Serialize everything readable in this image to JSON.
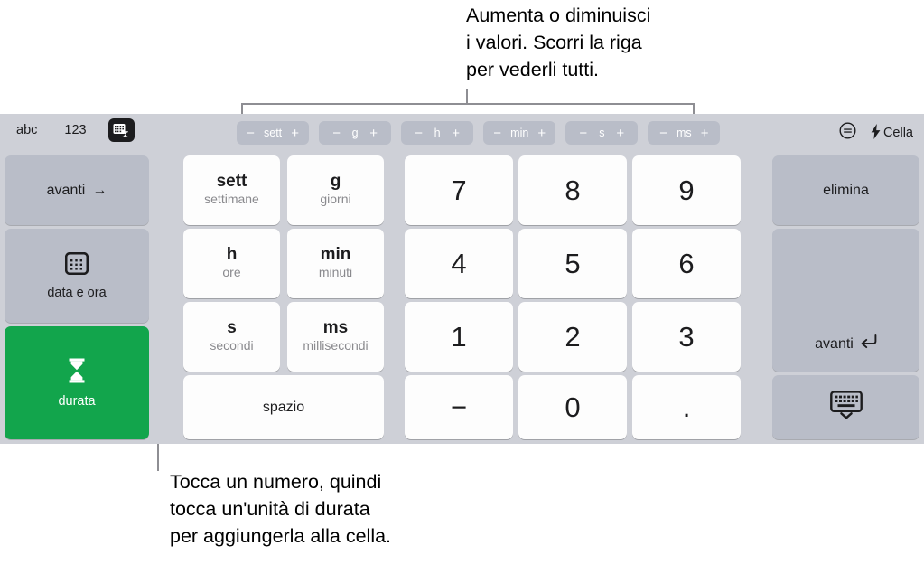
{
  "callouts": {
    "top": "Aumenta o diminuisci\ni valori. Scorri la riga\nper vederli tutti.",
    "bottom": "Tocca un numero, quindi\ntocca un'unità di durata\nper aggiungerla alla cella."
  },
  "toolbar": {
    "modes": [
      {
        "label": "abc",
        "name": "abc-mode"
      },
      {
        "label": "123",
        "name": "numeric-mode"
      }
    ],
    "duration_mode_icon": "duration-keypad-icon",
    "steppers": [
      {
        "unit": "sett",
        "minus": "−",
        "plus": "+"
      },
      {
        "unit": "g",
        "minus": "−",
        "plus": "+"
      },
      {
        "unit": "h",
        "minus": "−",
        "plus": "+"
      },
      {
        "unit": "min",
        "minus": "−",
        "plus": "+"
      },
      {
        "unit": "s",
        "minus": "−",
        "plus": "+"
      },
      {
        "unit": "ms",
        "minus": "−",
        "plus": "+"
      }
    ],
    "format_icon": "format-circle-icon",
    "cell_label": "Cella",
    "cell_icon": "lightning-bolt-icon"
  },
  "left_keys": {
    "next": {
      "label": "avanti",
      "arrow": "→"
    },
    "datetime": {
      "label": "data e ora",
      "icon": "calendar-icon"
    },
    "duration": {
      "label": "durata",
      "icon": "hourglass-icon",
      "color": "#12a54c"
    }
  },
  "unit_keys": [
    {
      "abbr": "sett",
      "full": "settimane"
    },
    {
      "abbr": "g",
      "full": "giorni"
    },
    {
      "abbr": "h",
      "full": "ore"
    },
    {
      "abbr": "min",
      "full": "minuti"
    },
    {
      "abbr": "s",
      "full": "secondi"
    },
    {
      "abbr": "ms",
      "full": "millisecondi"
    }
  ],
  "space_key": {
    "label": "spazio"
  },
  "number_keys": [
    {
      "label": "7"
    },
    {
      "label": "8"
    },
    {
      "label": "9"
    },
    {
      "label": "4"
    },
    {
      "label": "5"
    },
    {
      "label": "6"
    },
    {
      "label": "1"
    },
    {
      "label": "2"
    },
    {
      "label": "3"
    },
    {
      "label": "−"
    },
    {
      "label": "0"
    },
    {
      "label": "."
    }
  ],
  "right_keys": {
    "delete": {
      "label": "elimina"
    },
    "next": {
      "label": "avanti",
      "icon": "return-arrow-icon"
    },
    "dismiss": {
      "icon": "keyboard-dismiss-icon"
    }
  },
  "colors": {
    "keyboard_bg": "#ced0d7",
    "gray_key": "#b9bdc8",
    "white_key": "#fdfdfd",
    "green": "#12a54c",
    "leader": "#8e8e93"
  }
}
